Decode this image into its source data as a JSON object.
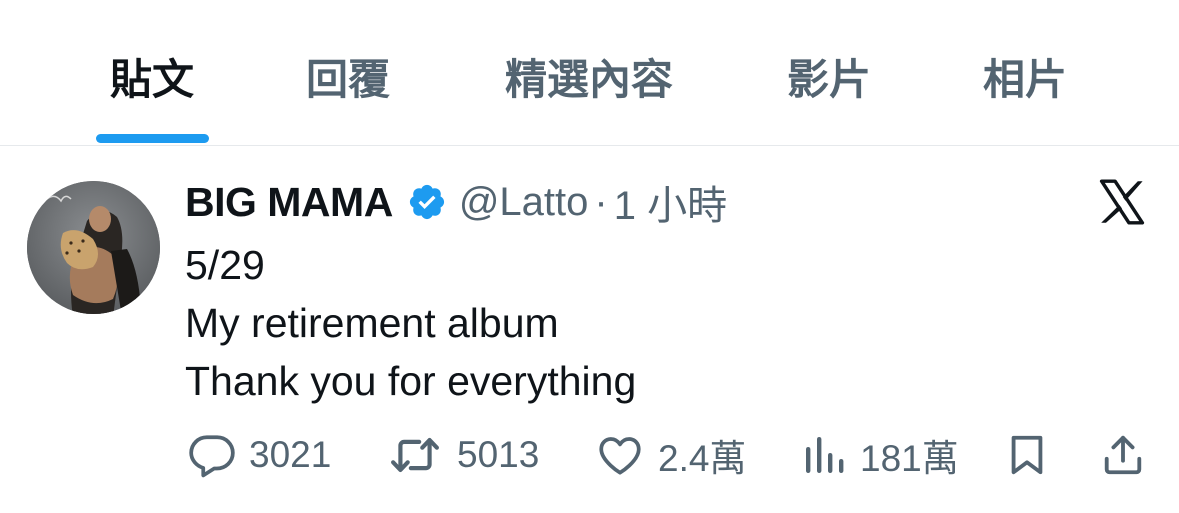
{
  "tabs": [
    {
      "label": "貼文",
      "active": true
    },
    {
      "label": "回覆",
      "active": false
    },
    {
      "label": "精選內容",
      "active": false
    },
    {
      "label": "影片",
      "active": false
    },
    {
      "label": "相片",
      "active": false
    }
  ],
  "tweet": {
    "display_name": "BIG MAMA",
    "handle": "@Latto",
    "separator": "·",
    "time": "1 小時",
    "lines": [
      "5/29",
      "My retirement album",
      "Thank you for everything"
    ]
  },
  "actions": {
    "replies": "3021",
    "reposts": "5013",
    "likes": "2.4萬",
    "views": "181萬"
  },
  "icons": {
    "verified": "verified-badge-icon",
    "platform": "x-logo-icon",
    "reply": "reply-icon",
    "repost": "repost-icon",
    "like": "heart-icon",
    "views": "views-bar-icon",
    "bookmark": "bookmark-icon",
    "share": "share-icon"
  },
  "colors": {
    "accent": "#1d9bf0",
    "text_primary": "#0f1419",
    "text_secondary": "#536471"
  }
}
